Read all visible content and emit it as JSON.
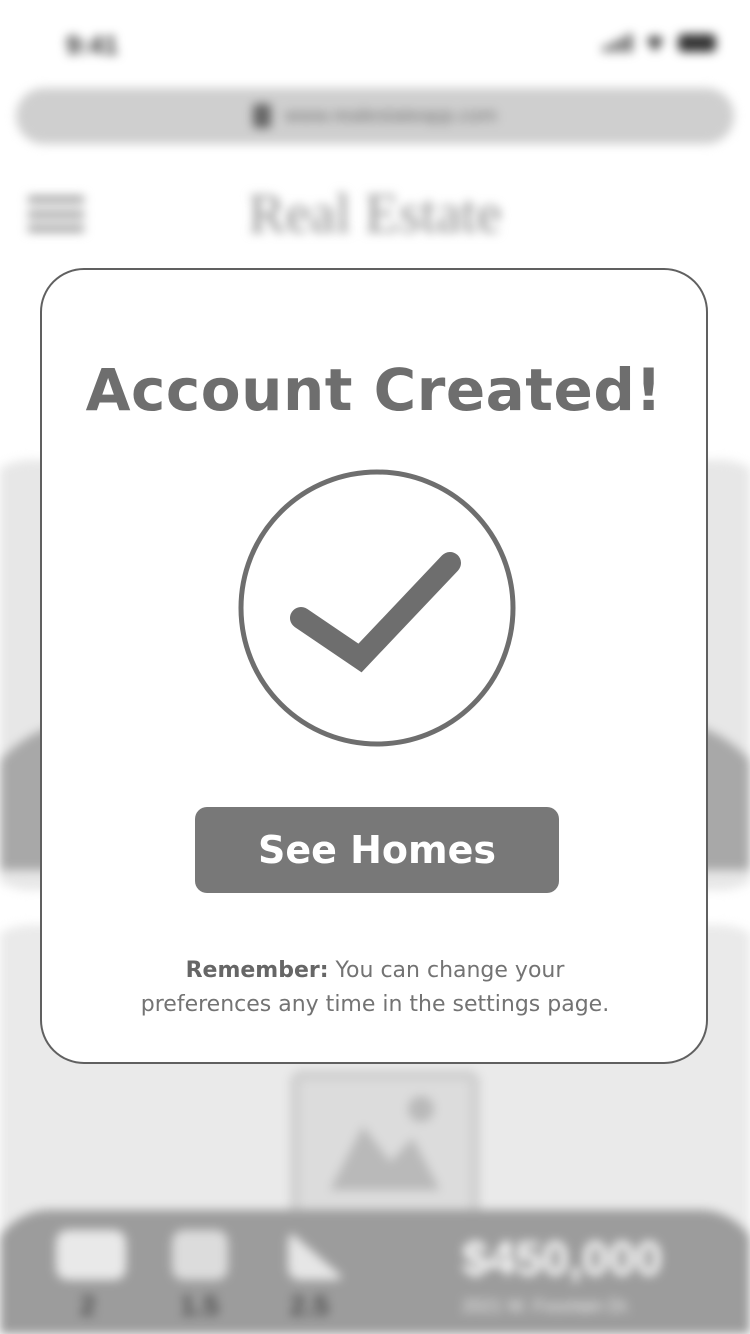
{
  "status_bar": {
    "time": "9:41"
  },
  "browser": {
    "url": "www.realestateapp.com"
  },
  "app": {
    "title": "Real Estate"
  },
  "listing": {
    "price": "$450,000",
    "address": "2021 W. Fountain Dr.",
    "features": [
      "2",
      "1.5",
      "2.5"
    ]
  },
  "modal": {
    "title": "Account Created!",
    "button_label": "See Homes",
    "note_label": "Remember:",
    "note_line1": " You can change your",
    "note_line2": "preferences any time in the settings page."
  },
  "colors": {
    "modal_border": "#606060",
    "button_bg": "#787878",
    "text_gray": "#6e6e6e"
  }
}
